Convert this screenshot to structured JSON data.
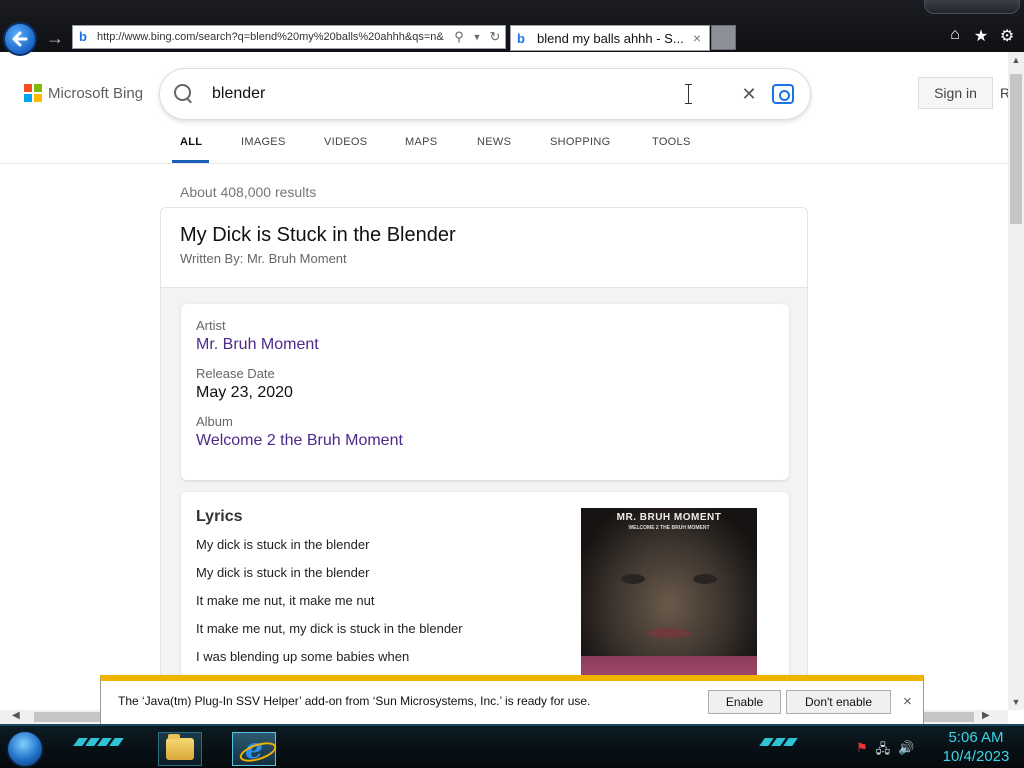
{
  "browser": {
    "url": "http://www.bing.com/search?q=blend%20my%20balls%20ahhh&qs=n&",
    "tab_title": "blend my balls ahhh - S...",
    "tab_close": "×",
    "toolbar_icons": [
      "home-icon",
      "star-icon",
      "gear-icon"
    ]
  },
  "bing": {
    "brand": "Microsoft Bing",
    "logo_colors": [
      "#f25022",
      "#7fba00",
      "#00a4ef",
      "#ffb900"
    ],
    "query": "blender",
    "sign_in": "Sign in",
    "rewards": "R",
    "tabs": [
      {
        "label": "ALL",
        "active": true
      },
      {
        "label": "IMAGES",
        "active": false
      },
      {
        "label": "VIDEOS",
        "active": false
      },
      {
        "label": "MAPS",
        "active": false
      },
      {
        "label": "NEWS",
        "active": false
      },
      {
        "label": "SHOPPING",
        "active": false
      },
      {
        "label": "TOOLS",
        "active": false
      }
    ],
    "result_count": "About 408,000 results"
  },
  "song": {
    "title": "My Dick is Stuck in the Blender",
    "written_by": "Written By: Mr. Bruh Moment",
    "artist_label": "Artist",
    "artist": "Mr. Bruh Moment",
    "release_label": "Release Date",
    "release_date": "May 23, 2020",
    "album_label": "Album",
    "album": "Welcome 2 the Bruh Moment",
    "lyrics_heading": "Lyrics",
    "lyrics": [
      "My dick is stuck in the blender",
      "My dick is stuck in the blender",
      "It make me nut, it make me nut",
      "It make me nut, my dick is stuck in the blender",
      "I was blending up some babies when"
    ],
    "cover_title": "MR. BRUH MOMENT",
    "cover_subtitle": "WELCOME 2 THE BRUH MOMENT"
  },
  "notification": {
    "message": "The ‘Java(tm) Plug-In SSV Helper’ add-on from ‘Sun Microsystems, Inc.’ is ready for use.",
    "enable": "Enable",
    "dont_enable": "Don't enable",
    "close": "×"
  },
  "taskbar": {
    "time": "5:06 AM",
    "date": "10/4/2023"
  }
}
